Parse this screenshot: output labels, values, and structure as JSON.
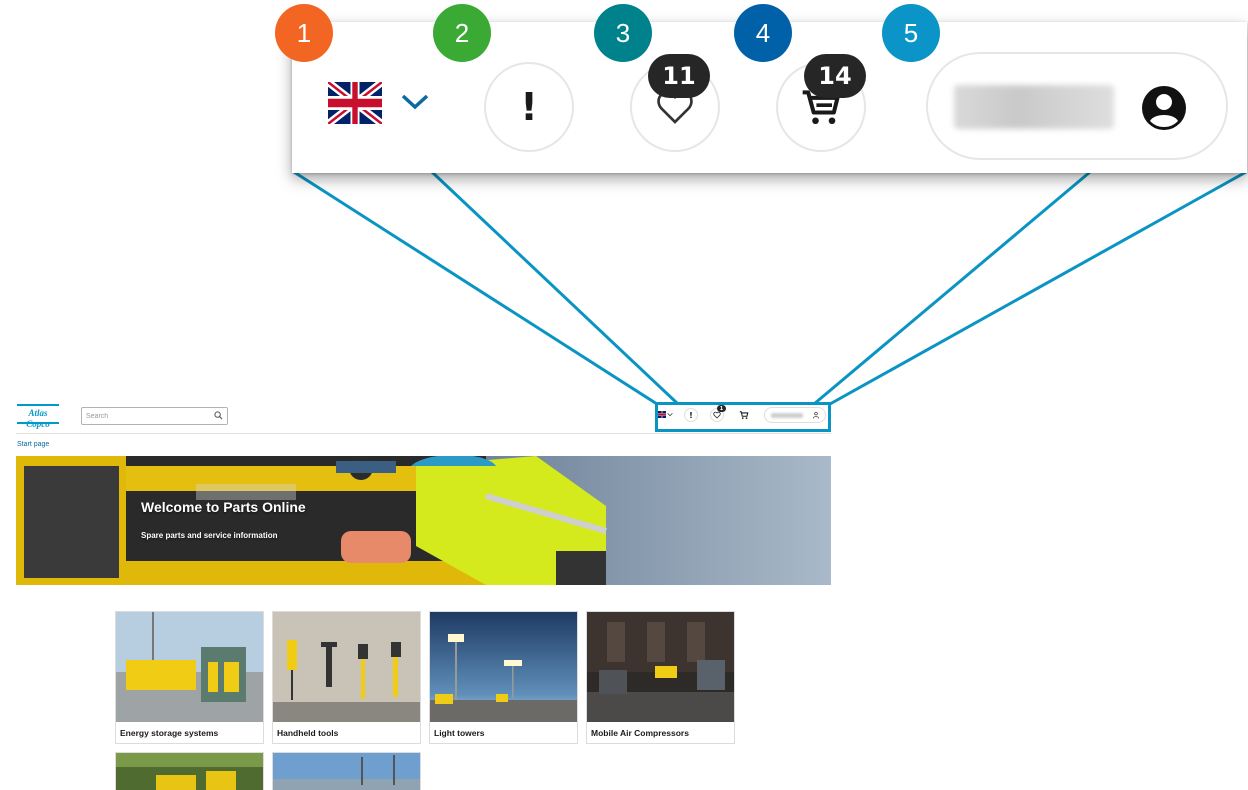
{
  "callouts": [
    {
      "number": "1",
      "color": "#f26522"
    },
    {
      "number": "2",
      "color": "#3aaa35"
    },
    {
      "number": "3",
      "color": "#00828c"
    },
    {
      "number": "4",
      "color": "#0061a8"
    },
    {
      "number": "5",
      "color": "#0b94c7"
    }
  ],
  "zoom": {
    "language_flag_icon": "uk-flag-icon",
    "alert_symbol": "!",
    "favorites_count": "11",
    "cart_count": "14",
    "account_icon": "person-icon"
  },
  "header": {
    "logo_text": "Atlas Copco",
    "search_placeholder": "Search",
    "alert_symbol": "!",
    "favorites_count": "1"
  },
  "breadcrumb": "Start page",
  "hero": {
    "title": "Welcome to Parts Online",
    "subtitle": "Spare parts and service information"
  },
  "categories": [
    {
      "label": "Energy storage systems"
    },
    {
      "label": "Handheld tools"
    },
    {
      "label": "Light towers"
    },
    {
      "label": "Mobile Air Compressors"
    }
  ],
  "colors": {
    "accent": "#0a94c4",
    "brand": "#0099cc",
    "badge_dark": "#262626"
  }
}
